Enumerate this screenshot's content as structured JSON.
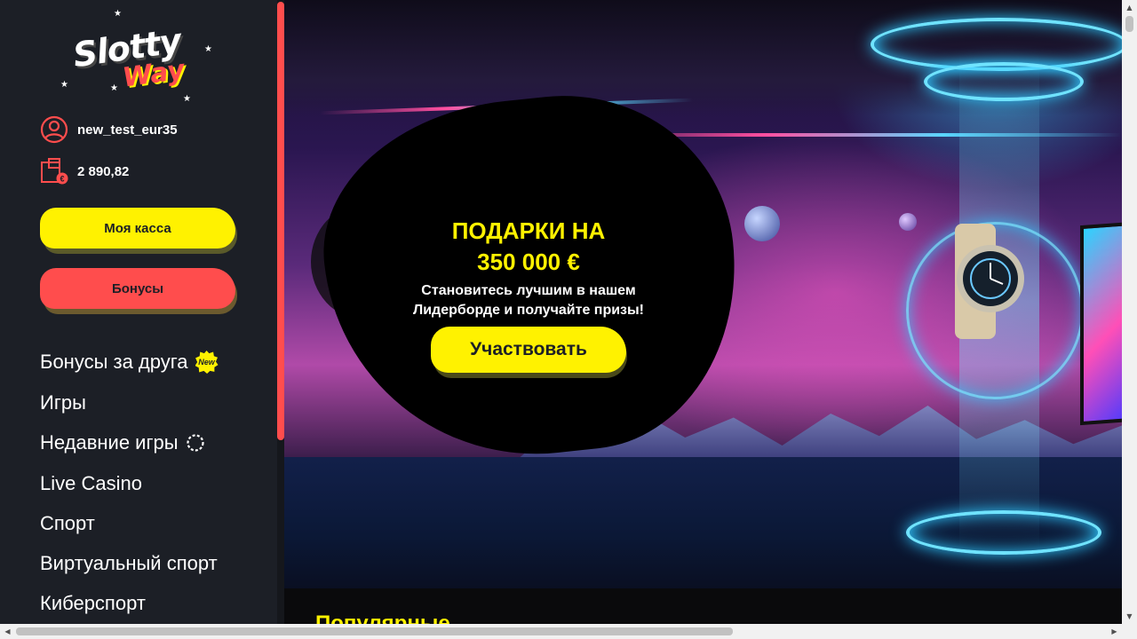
{
  "brand": {
    "logo_line1": "Slotty",
    "logo_line2": "Way",
    "accent_yellow": "#fff200",
    "accent_red": "#ff4d4d",
    "sidebar_bg": "#1c1f26"
  },
  "user": {
    "username": "new_test_eur35",
    "balance": "2 890,82",
    "user_icon": "user-circle-icon",
    "wallet_icon": "wallet-euro-icon"
  },
  "buttons": {
    "cashier_label": "Моя касса",
    "bonuses_label": "Бонусы"
  },
  "nav": {
    "items": [
      {
        "label": "Бонусы за друга",
        "badge": "New"
      },
      {
        "label": "Игры"
      },
      {
        "label": "Недавние игры",
        "icon": "loading-spinner-icon"
      },
      {
        "label": "Live Casino"
      },
      {
        "label": "Спорт"
      },
      {
        "label": "Виртуальный спорт"
      },
      {
        "label": "Киберспорт"
      }
    ]
  },
  "banner": {
    "title_line1": "ПОДАРКИ НА",
    "title_line2": "350 000 €",
    "subtitle_line1": "Становитесь лучшим в нашем",
    "subtitle_line2": "Лидерборде и получайте призы!",
    "cta_label": "Участвовать"
  },
  "sections": {
    "popular_title": "Популярные"
  }
}
